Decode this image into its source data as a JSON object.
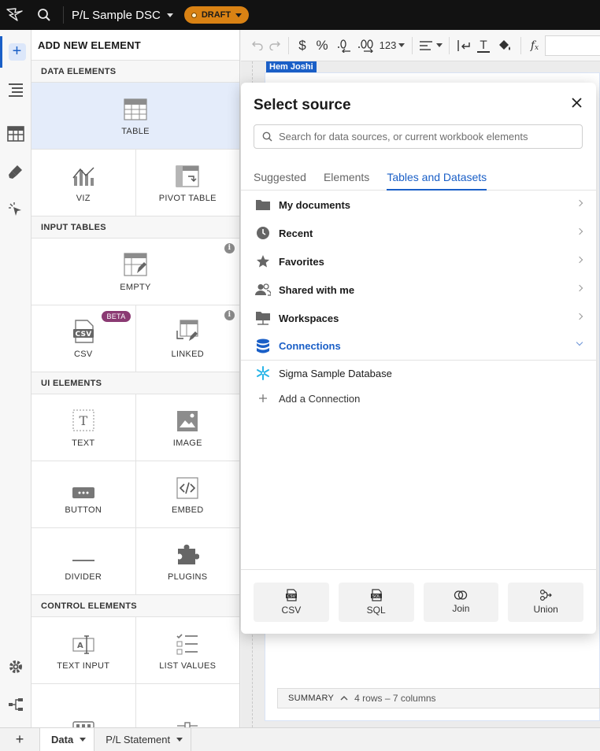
{
  "topbar": {
    "doc_title": "P/L Sample DSC",
    "status_badge": "DRAFT"
  },
  "panel": {
    "title": "ADD NEW ELEMENT",
    "sections": {
      "data": "DATA ELEMENTS",
      "input": "INPUT TABLES",
      "ui": "UI ELEMENTS",
      "control": "CONTROL ELEMENTS"
    },
    "tiles": {
      "table": "TABLE",
      "viz": "VIZ",
      "pivot": "PIVOT TABLE",
      "empty": "EMPTY",
      "csv": "CSV",
      "csv_badge": "BETA",
      "linked": "LINKED",
      "text": "TEXT",
      "image": "IMAGE",
      "button": "BUTTON",
      "embed": "EMBED",
      "divider": "DIVIDER",
      "plugins": "PLUGINS",
      "text_input": "TEXT INPUT",
      "list_values": "LIST VALUES"
    }
  },
  "toolbar": {
    "number_format": "123"
  },
  "canvas": {
    "user_tag": "Hem Joshi",
    "summary_label": "SUMMARY",
    "summary_info": "4 rows – 7 columns"
  },
  "popup": {
    "title": "Select source",
    "search_placeholder": "Search for data sources, or current workbook elements",
    "tabs": [
      "Suggested",
      "Elements",
      "Tables and Datasets"
    ],
    "items": {
      "my_documents": "My documents",
      "recent": "Recent",
      "favorites": "Favorites",
      "shared": "Shared with me",
      "workspaces": "Workspaces",
      "connections": "Connections"
    },
    "connection_items": {
      "sigma_db": "Sigma Sample Database",
      "add_connection": "Add a Connection"
    },
    "footer": {
      "csv": "CSV",
      "sql": "SQL",
      "join": "Join",
      "union": "Union"
    }
  },
  "bottom_tabs": {
    "data": "Data",
    "pl_statement": "P/L Statement"
  },
  "colors": {
    "accent": "#1a5fc7",
    "draft": "#d98214",
    "beta": "#8b3a73"
  }
}
